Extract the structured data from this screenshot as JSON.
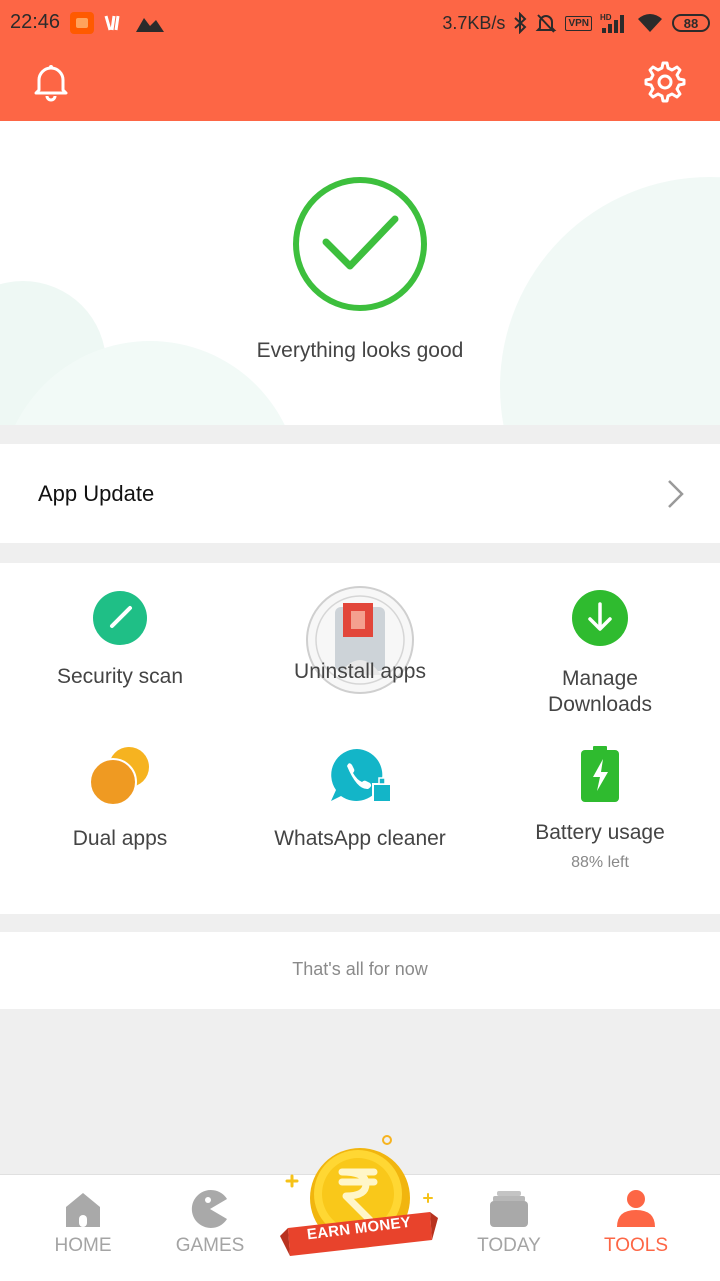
{
  "status_bar": {
    "time": "22:46",
    "net_speed": "3.7KB/s",
    "vpn": "VPN",
    "battery": "88"
  },
  "header": {
    "left_icon": "bell-icon",
    "right_icon": "gear-icon",
    "color": "#fd6645"
  },
  "hero": {
    "message": "Everything looks good",
    "check_color": "#3dbf3d"
  },
  "app_update": {
    "label": "App Update"
  },
  "tools": [
    {
      "label": "Security scan",
      "icon": "security-scan-icon"
    },
    {
      "label": "Uninstall apps",
      "icon": "uninstall-apps-icon"
    },
    {
      "label": "Manage Downloads",
      "icon": "download-icon"
    },
    {
      "label": "Dual apps",
      "icon": "dual-apps-icon"
    },
    {
      "label": "WhatsApp cleaner",
      "icon": "whatsapp-cleaner-icon"
    },
    {
      "label": "Battery usage",
      "sub": "88% left",
      "icon": "battery-icon"
    }
  ],
  "footer_note": "That's all for now",
  "bottom_nav": {
    "items": [
      {
        "label": "HOME",
        "icon": "home-icon"
      },
      {
        "label": "GAMES",
        "icon": "games-icon"
      },
      {
        "label": "EARN MONEY",
        "icon": "rupee-coin-icon"
      },
      {
        "label": "TODAY",
        "icon": "today-icon"
      },
      {
        "label": "TOOLS",
        "icon": "tools-person-icon",
        "active": true
      }
    ],
    "active_color": "#fd6645"
  }
}
